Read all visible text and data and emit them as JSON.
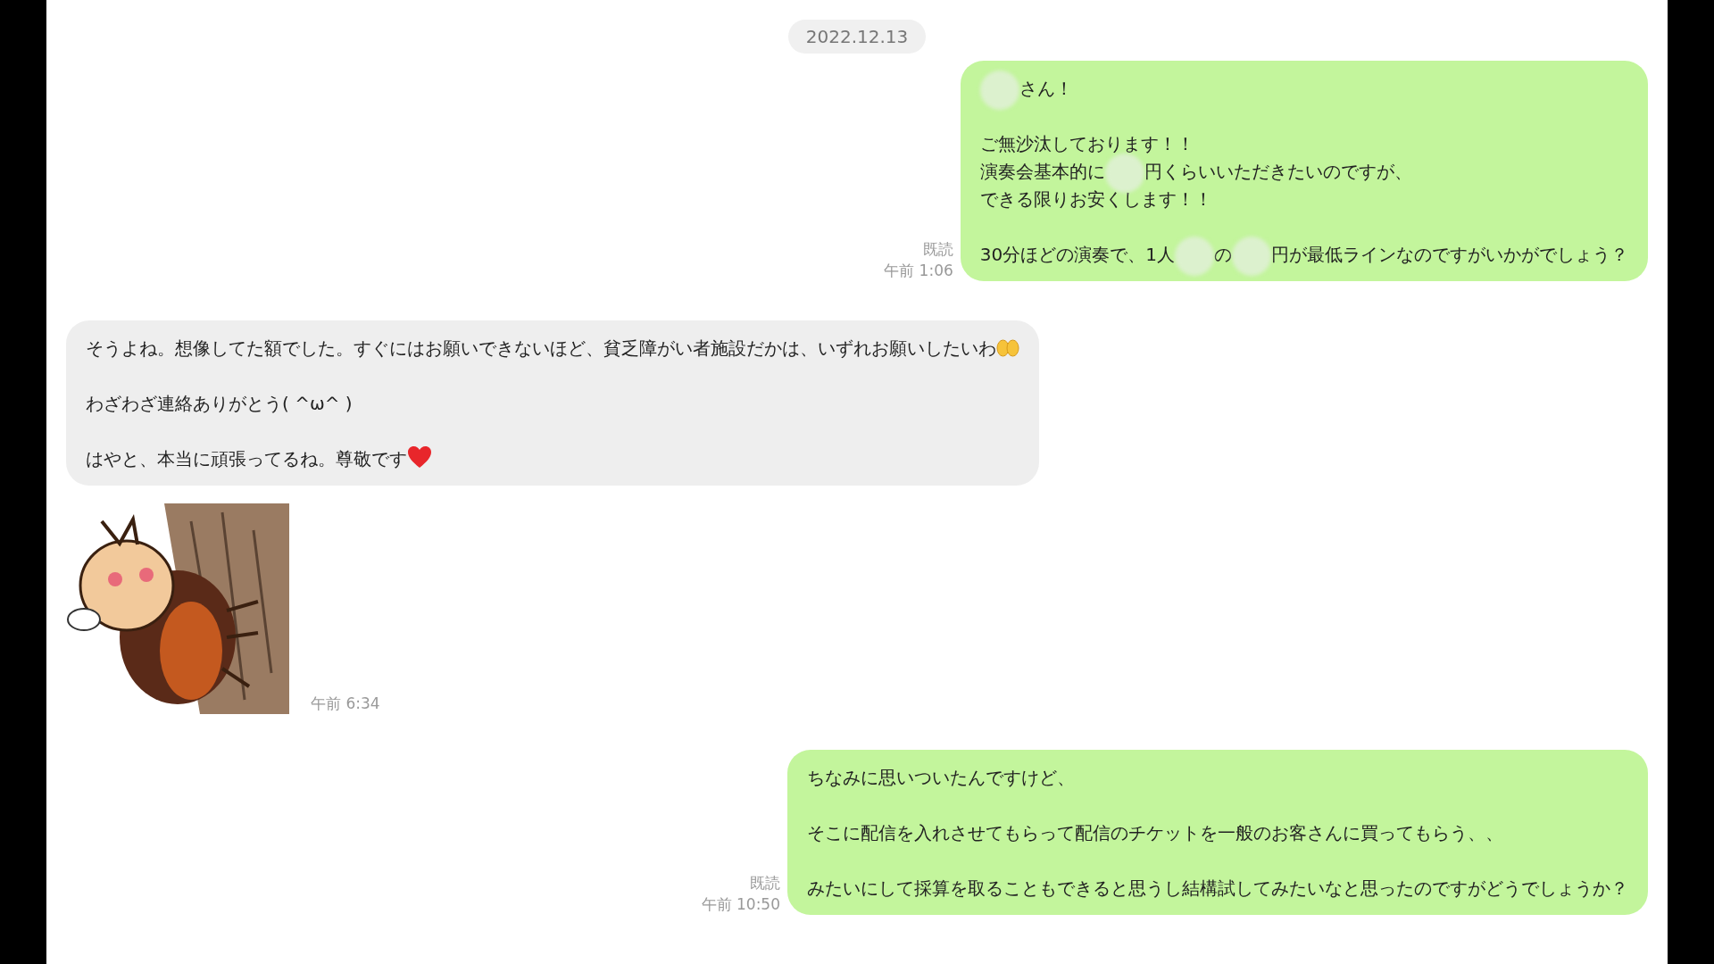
{
  "date": "2022.12.13",
  "messages": [
    {
      "kind": "outgoing",
      "read": "既読",
      "time": "午前 1:06",
      "paragraphs": [
        [
          [
            {
              "kind": "blur"
            },
            {
              "kind": "text",
              "text": "さん！"
            }
          ]
        ],
        [
          [
            {
              "kind": "text",
              "text": "ご無沙汰しております！！"
            }
          ],
          [
            {
              "kind": "text",
              "text": "演奏会基本的に"
            },
            {
              "kind": "blur"
            },
            {
              "kind": "text",
              "text": "円くらいいただきたいのですが、"
            }
          ],
          [
            {
              "kind": "text",
              "text": "できる限りお安くします！！"
            }
          ]
        ],
        [
          [
            {
              "kind": "text",
              "text": "30分ほどの演奏で、1人"
            },
            {
              "kind": "blur"
            },
            {
              "kind": "text",
              "text": "の"
            },
            {
              "kind": "blur"
            },
            {
              "kind": "text",
              "text": "円が最低ラインなのですがいかがでしょう？"
            }
          ]
        ]
      ]
    },
    {
      "kind": "incoming",
      "paragraphs": [
        [
          [
            {
              "kind": "text",
              "text": "そうよね。想像してた額でした。すぐにはお願いできないほど、貧乏障がい者施設だかは、いずれお願いしたいわ"
            },
            {
              "kind": "hands"
            }
          ]
        ],
        [
          [
            {
              "kind": "text",
              "text": "わざわざ連絡ありがとう( ^ω^ )"
            }
          ]
        ],
        [
          [
            {
              "kind": "text",
              "text": "はやと、本当に頑張ってるね。尊敬です"
            },
            {
              "kind": "heart"
            }
          ]
        ]
      ]
    },
    {
      "kind": "sticker",
      "time": "午前 6:34"
    },
    {
      "kind": "outgoing",
      "read": "既読",
      "time": "午前 10:50",
      "paragraphs": [
        [
          [
            {
              "kind": "text",
              "text": "ちなみに思いついたんですけど、"
            }
          ]
        ],
        [
          [
            {
              "kind": "text",
              "text": "そこに配信を入れさせてもらって配信のチケットを一般のお客さんに買ってもらう、、"
            }
          ]
        ],
        [
          [
            {
              "kind": "text",
              "text": "みたいにして採算を取ることもできると思うし結構試してみたいなと思ったのですがどうでしょうか？"
            }
          ]
        ]
      ]
    }
  ]
}
